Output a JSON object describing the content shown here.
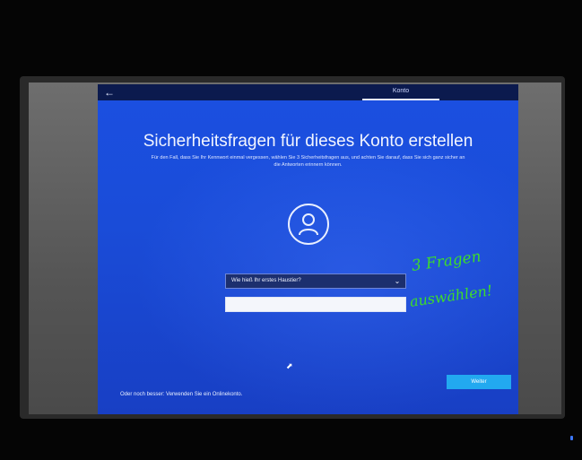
{
  "window": {
    "back_icon": "back-arrow-icon",
    "tab_label": "Konto"
  },
  "page": {
    "title": "Sicherheitsfragen für dieses Konto erstellen",
    "subtitle_line1": "Für den Fall, dass Sie Ihr Kennwort einmal vergessen, wählen Sie 3 Sicherheitsfragen aus, und achten Sie darauf, dass Sie sich ganz sicher an",
    "subtitle_line2": "die Antworten erinnern können."
  },
  "form": {
    "question_selected": "Wie hieß Ihr erstes Haustier?",
    "answer_value": ""
  },
  "footer": {
    "alternative_link": "Oder noch besser: Verwenden Sie ein Onlinekonto.",
    "next_label": "Weiter"
  },
  "annotation": {
    "line1": "3 Fragen",
    "line2": "auswählen!",
    "color": "#3ddc2b"
  },
  "colors": {
    "oobe_blue": "#1b4fe0",
    "accent_button": "#22a9f0"
  }
}
